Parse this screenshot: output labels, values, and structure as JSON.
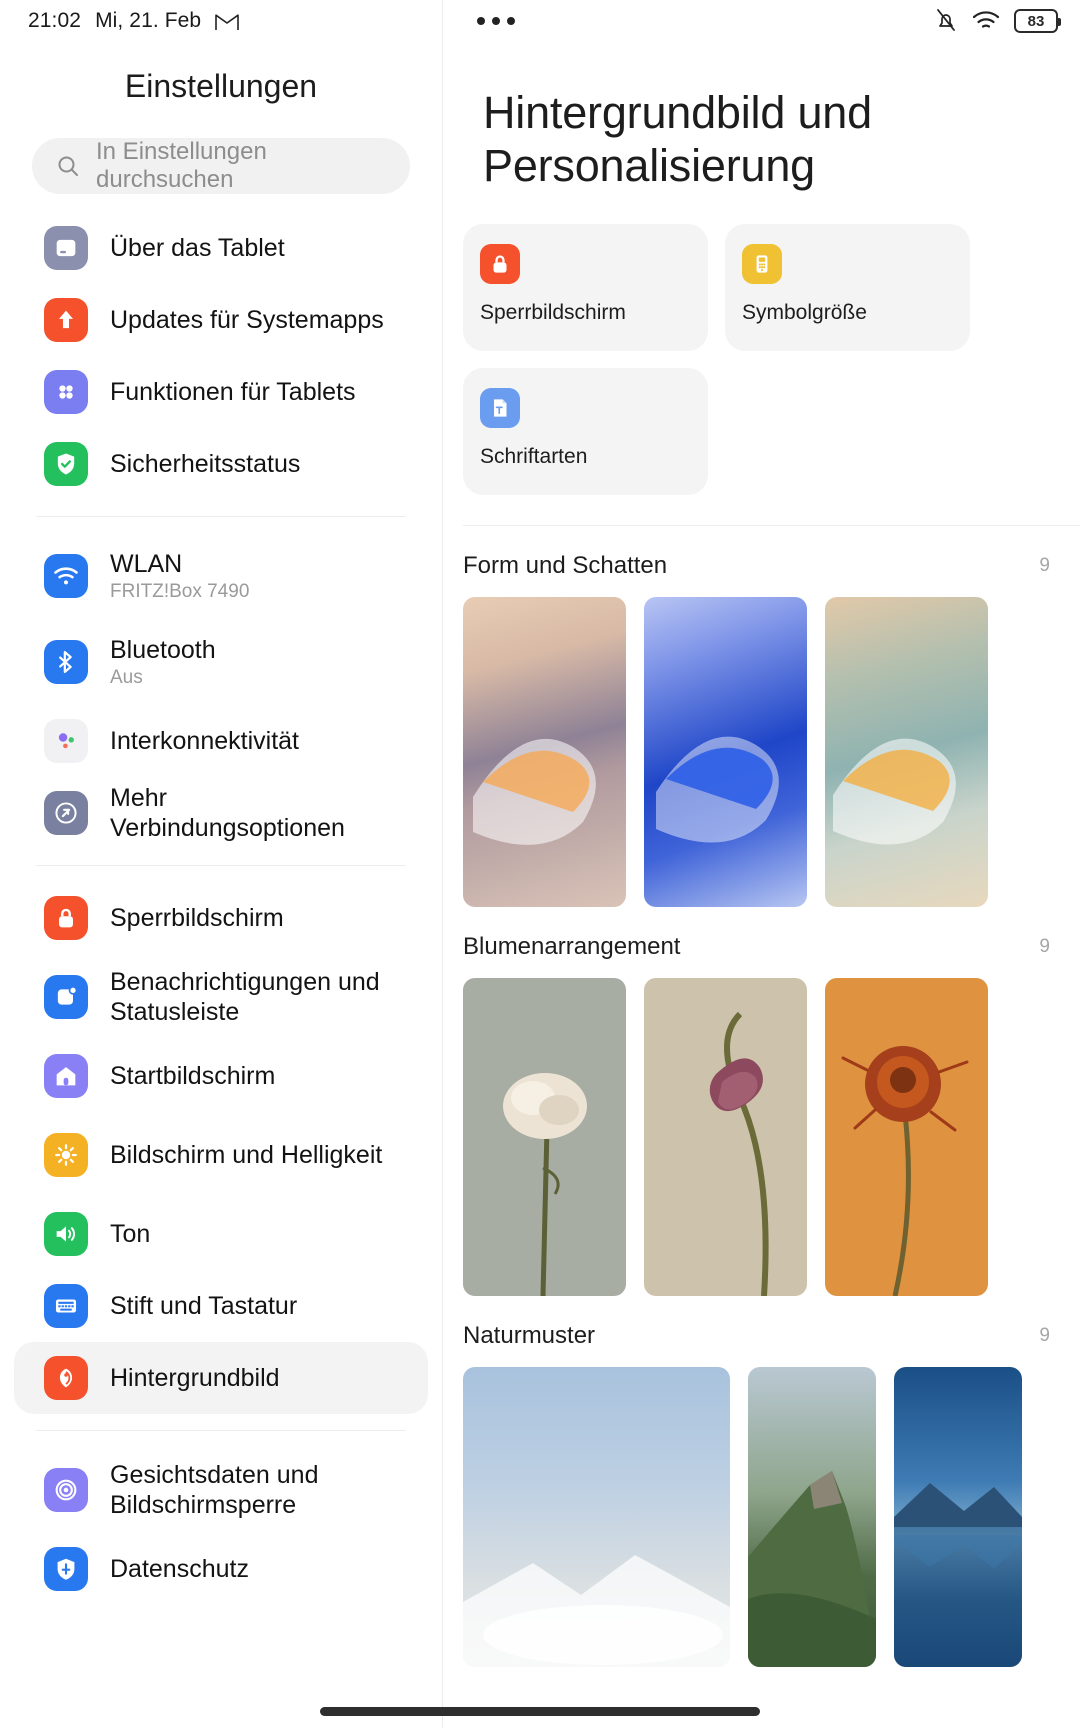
{
  "status_bar": {
    "time": "21:02",
    "date": "Mi, 21. Feb",
    "mail_icon": "gmail-icon",
    "overflow_icon": "more-dots-icon",
    "silent_icon": "bell-muted-icon",
    "wifi_icon": "wifi-icon",
    "battery_level": "83"
  },
  "sidebar": {
    "title": "Einstellungen",
    "search": {
      "placeholder": "In Einstellungen durchsuchen",
      "icon": "search-icon"
    },
    "items": [
      {
        "label": "Über das Tablet",
        "sub": "",
        "icon": "tablet-icon",
        "color": "#8b90ae",
        "selected": false
      },
      {
        "label": "Updates für Systemapps",
        "sub": "",
        "icon": "upload-arrow-icon",
        "color": "#f4512c",
        "selected": false
      },
      {
        "label": "Funktionen für Tablets",
        "sub": "",
        "icon": "grid-dots-icon",
        "color": "#7b7ef0",
        "selected": false
      },
      {
        "label": "Sicherheitsstatus",
        "sub": "",
        "icon": "shield-check-icon",
        "color": "#25c05e",
        "selected": false
      },
      {
        "label": "WLAN",
        "sub": "FRITZ!Box 7490",
        "icon": "wifi-icon",
        "color": "#2878f0",
        "selected": false
      },
      {
        "label": "Bluetooth",
        "sub": "Aus",
        "icon": "bluetooth-icon",
        "color": "#2878f0",
        "selected": false
      },
      {
        "label": "Interkonnektivität",
        "sub": "",
        "icon": "interconnect-dots-icon",
        "color": "#f1f1f3",
        "selected": false
      },
      {
        "label": "Mehr Verbindungsoptionen",
        "sub": "",
        "icon": "link-icon",
        "color": "#7a80a0",
        "selected": false
      },
      {
        "label": "Sperrbildschirm",
        "sub": "",
        "icon": "lock-icon",
        "color": "#f4512c",
        "selected": false
      },
      {
        "label": "Benachrichtigungen und Statusleiste",
        "sub": "",
        "icon": "notification-icon",
        "color": "#2878f0",
        "selected": false
      },
      {
        "label": "Startbildschirm",
        "sub": "",
        "icon": "home-icon",
        "color": "#8a80f5",
        "selected": false
      },
      {
        "label": "Bildschirm und Helligkeit",
        "sub": "",
        "icon": "brightness-icon",
        "color": "#f5b124",
        "selected": false
      },
      {
        "label": "Ton",
        "sub": "",
        "icon": "speaker-icon",
        "color": "#25c05e",
        "selected": false
      },
      {
        "label": "Stift und Tastatur",
        "sub": "",
        "icon": "keyboard-icon",
        "color": "#2878f0",
        "selected": false
      },
      {
        "label": "Hintergrundbild",
        "sub": "",
        "icon": "wallpaper-flower-icon",
        "color": "#f4512c",
        "selected": true
      },
      {
        "label": "Gesichtsdaten und Bildschirmsperre",
        "sub": "",
        "icon": "face-unlock-icon",
        "color": "#8a80f5",
        "selected": false
      },
      {
        "label": "Datenschutz",
        "sub": "",
        "icon": "privacy-icon",
        "color": "#2878f0",
        "selected": false
      }
    ],
    "divider_after": [
      3,
      7,
      14
    ]
  },
  "main": {
    "title": "Hintergrundbild und Personalisierung",
    "tiles": [
      {
        "label": "Sperrbildschirm",
        "icon": "lock-icon",
        "color": "#f4512c"
      },
      {
        "label": "Symbolgröße",
        "icon": "icon-size-icon",
        "color": "#f0c133"
      },
      {
        "label": "Schriftarten",
        "icon": "font-file-icon",
        "color": "#6a9df0"
      }
    ],
    "sections": [
      {
        "title": "Form und Schatten",
        "count": "9",
        "thumbs": [
          {
            "name": "wallpaper-shape-peach"
          },
          {
            "name": "wallpaper-shape-blue"
          },
          {
            "name": "wallpaper-shape-teal"
          }
        ]
      },
      {
        "title": "Blumenarrangement",
        "count": "9",
        "thumbs": [
          {
            "name": "wallpaper-flower-white"
          },
          {
            "name": "wallpaper-flower-pink"
          },
          {
            "name": "wallpaper-flower-orange"
          }
        ]
      },
      {
        "title": "Naturmuster",
        "count": "9",
        "thumbs": [
          {
            "name": "wallpaper-nature-fog"
          },
          {
            "name": "wallpaper-nature-cliff"
          },
          {
            "name": "wallpaper-nature-lake"
          }
        ]
      }
    ]
  },
  "colors": {
    "accent": "#f4512c",
    "selected_bg": "#f3f3f3",
    "tile_bg": "#f4f4f4",
    "divider": "#ededed",
    "muted_text": "#a6a6a6"
  }
}
